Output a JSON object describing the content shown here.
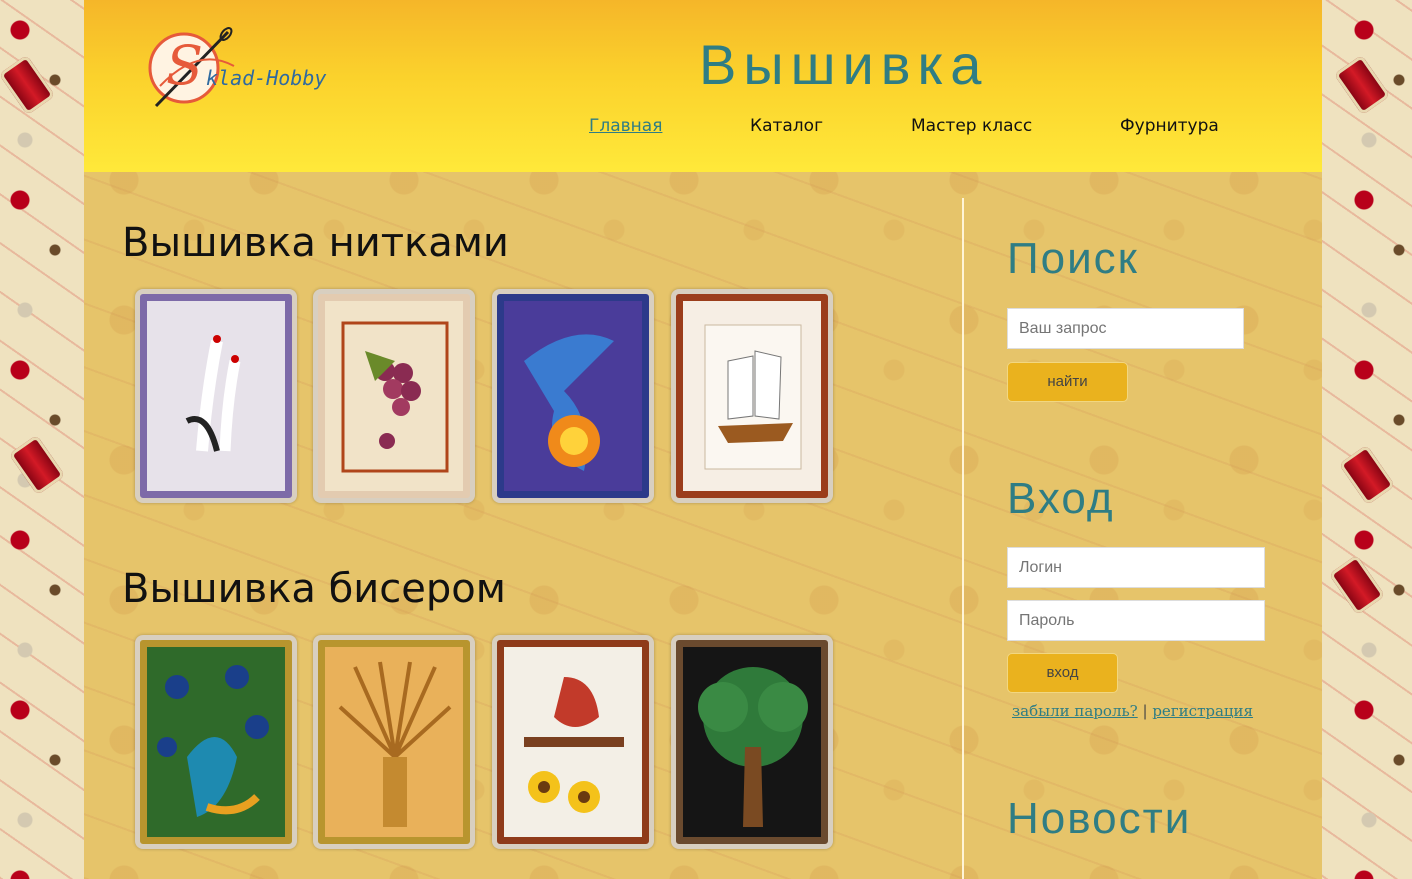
{
  "header": {
    "logo_text": "klad-Hobby",
    "logo_letter": "S",
    "title": "Вышивка",
    "nav": [
      {
        "label": "Главная",
        "active": true
      },
      {
        "label": "Каталог",
        "active": false
      },
      {
        "label": "Мастер класс",
        "active": false
      },
      {
        "label": "Фурнитура",
        "active": false
      }
    ]
  },
  "main": {
    "sections": [
      {
        "title": "Вышивка нитками",
        "items": [
          {
            "subject": "cranes",
            "frame_color": "#7d6aa8"
          },
          {
            "subject": "grapes",
            "frame_color": "#e3cbb0"
          },
          {
            "subject": "firebird",
            "frame_color": "#2c3a8a"
          },
          {
            "subject": "sailing-ship",
            "frame_color": "#9b3d1b"
          }
        ]
      },
      {
        "title": "Вышивка бисером",
        "items": [
          {
            "subject": "peacocks",
            "frame_color": "#b8952e"
          },
          {
            "subject": "wheat-sheaf",
            "frame_color": "#b8952e"
          },
          {
            "subject": "rooster",
            "frame_color": "#8f3b1a"
          },
          {
            "subject": "money-tree",
            "frame_color": "#6a4a2e"
          }
        ]
      }
    ]
  },
  "sidebar": {
    "search": {
      "title": "Поиск",
      "placeholder": "Ваш запрос",
      "button_label": "найти"
    },
    "login": {
      "title": "Вход",
      "login_placeholder": "Логин",
      "password_placeholder": "Пароль",
      "button_label": "вход",
      "forgot_label": "забыли пароль?",
      "separator": "|",
      "register_label": "регистрация"
    },
    "news": {
      "title": "Новости"
    }
  },
  "colors": {
    "accent": "#2f7d84",
    "header_top": "#f5b629",
    "header_bottom": "#ffe93a",
    "button": "#eab21e",
    "content_bg": "#e6c46a"
  }
}
